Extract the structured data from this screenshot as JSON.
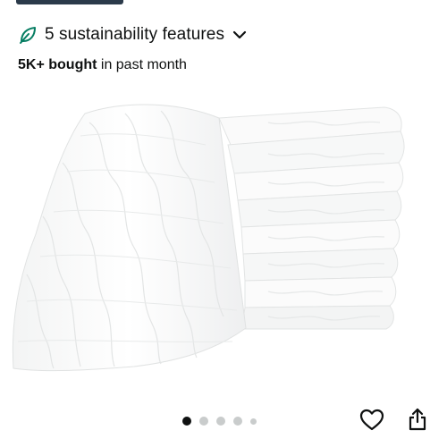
{
  "sustainability": {
    "label": "5 sustainability features",
    "icon": "leaf-icon",
    "chevron": "chevron-down-icon",
    "accent_color": "#067d62"
  },
  "purchase_stat": {
    "bold_text": "5K+ bought",
    "rest_text": " in past month"
  },
  "product_image": {
    "subject": "stack of white muslin burp cloths"
  },
  "carousel": {
    "total_dots": 5,
    "active_index": 0
  },
  "actions": {
    "favorite_icon": "heart-icon",
    "share_icon": "share-icon"
  }
}
